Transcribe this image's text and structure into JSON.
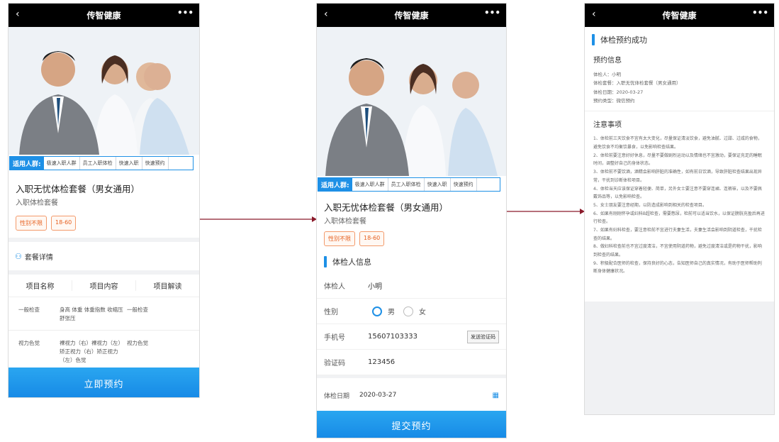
{
  "app_title": "传智健康",
  "screen1": {
    "tags_lead": "适用人群:",
    "tags": [
      "极速入职人群",
      "员工入职体检",
      "快速入职",
      "快速预约"
    ],
    "package_name": "入职无忧体检套餐（男女通用）",
    "package_sub": "入职体检套餐",
    "chips": [
      "性别不限",
      "18-60"
    ],
    "detail_title": "套餐详情",
    "table_headers": [
      "项目名称",
      "项目内容",
      "项目解读"
    ],
    "rows": [
      {
        "name": "一般检查",
        "content": "身高 体重 体重指数 收缩压 舒张压",
        "explain": "一般检查"
      },
      {
        "name": "视力色觉",
        "content": "裸视力（右）裸视力（左）矫正视力（右）矫正视力（左）色觉",
        "explain": "视力色觉"
      }
    ],
    "cta": "立即预约"
  },
  "screen2": {
    "tags_lead": "适用人群:",
    "tags": [
      "极速入职人群",
      "员工入职体检",
      "快速入职",
      "快速预约"
    ],
    "package_name": "入职无忧体检套餐（男女通用）",
    "package_sub": "入职体检套餐",
    "chips": [
      "性别不限",
      "18-60"
    ],
    "section_title": "体检人信息",
    "name_label": "体检人",
    "name_value": "小明",
    "gender_label": "性别",
    "gender_male": "男",
    "gender_female": "女",
    "phone_label": "手机号",
    "phone_value": "15607103333",
    "sms_button": "发送验证码",
    "code_label": "验证码",
    "code_value": "123456",
    "date_label": "体检日期",
    "date_value": "2020-03-27",
    "cta": "提交预约"
  },
  "screen3": {
    "title": "体检预约成功",
    "info_title": "预约信息",
    "info": [
      "体检人：小明",
      "体检套餐：入职无忧体检套餐（男女通用）",
      "体检日期：2020-03-27",
      "预约类型：微信预约"
    ],
    "notes_title": "注意事项",
    "notes": [
      "1、体检前三天饮食不宜有太大变化，尽量保证清淡饮食，避免油腻、过甜、过咸的食物，避免饮食不均衡饮暴食，以免影响检查结果。",
      "2、体检前要注意好好休息，尽量不要做剧烈运动以及情绪也不宜激动，要保证充足的睡眠时间，调整好自己的身体状态。",
      "3、体检前不要饮酒，酒精会影响肝脏的准确性，如有前日饮酒，导致肝脏检查结果出现异常，干扰到诊断体检项目。",
      "4、体检当天应该保证穿着轻便、简单，另外女士要注意不要穿连裙、连裤袜，以及不要佩戴饰品等，以免影响检查。",
      "5、女士朋友要注意经期，以防造成影响到相关的检查项目。",
      "6、如果有刚刚怀孕或妇科B超检查，需要憋尿，检前可以适当饮水，以保证膀胱充盈后再进行检查。",
      "7、如果有妇科检查，要注意检前不宜进行夫妻生活，夫妻生活会影响到阴道检查，干扰检查的结果。",
      "8、做妇科检查前也不宜过度清洁，不宜使用阴道药物，避免过度清洁或是药物干扰，影响到检查的结果。",
      "9、积极配合医师的检查，保持良好的心态，告知医师自己的真实情况，有助于医师帮助判断身体健康状况。"
    ]
  }
}
